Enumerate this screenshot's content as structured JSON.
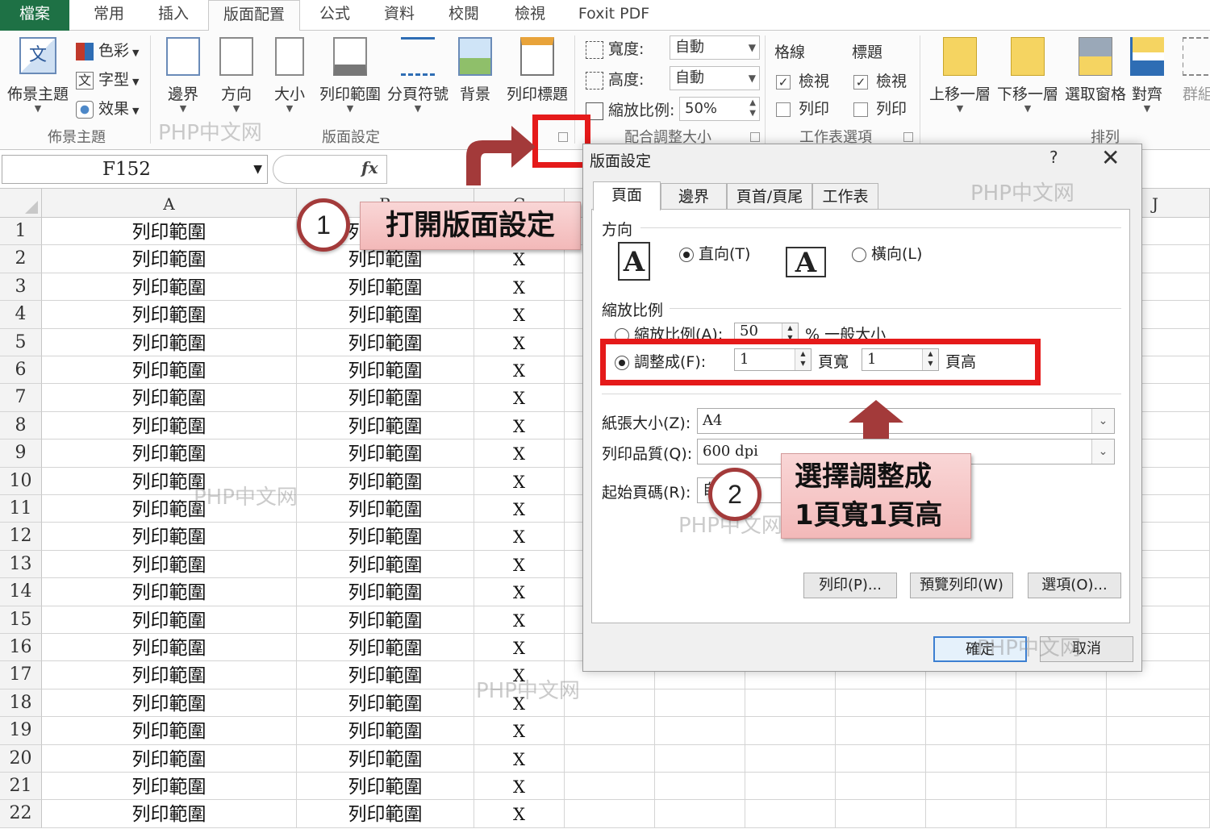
{
  "tabs": [
    "檔案",
    "常用",
    "插入",
    "版面配置",
    "公式",
    "資料",
    "校閱",
    "檢視",
    "Foxit PDF"
  ],
  "ribbon": {
    "theme_group": {
      "theme_button": "佈景主題",
      "colors": "色彩",
      "fonts": "字型",
      "effects": "效果",
      "label": "佈景主題"
    },
    "page_setup_group": {
      "buttons": [
        "邊界",
        "方向",
        "大小",
        "列印範圍",
        "分頁符號",
        "背景",
        "列印標題"
      ],
      "label": "版面設定"
    },
    "scale_group": {
      "width_label": "寬度:",
      "width_value": "自動",
      "height_label": "高度:",
      "height_value": "自動",
      "scale_label": "縮放比例:",
      "scale_value": "50%",
      "label": "配合調整大小"
    },
    "sheet_options_group": {
      "gridlines": "格線",
      "headings": "標題",
      "view": "檢視",
      "print": "列印",
      "label": "工作表選項"
    },
    "arrange_group": {
      "buttons": [
        "上移一層",
        "下移一層",
        "選取窗格",
        "對齊",
        "群組"
      ],
      "label": "排列"
    }
  },
  "formula_bar": {
    "name_box": "F152",
    "fx": "fx"
  },
  "sheet": {
    "columns": [
      "A",
      "B",
      "C",
      "J"
    ],
    "cell_text_a": "列印範圍",
    "cell_text_b": "列印範圍",
    "cell_text_c": "X",
    "rows": [
      1,
      2,
      3,
      4,
      5,
      6,
      7,
      8,
      9,
      10,
      11,
      12,
      13,
      14,
      15,
      16,
      17,
      18,
      19,
      20,
      21,
      22
    ]
  },
  "dialog": {
    "title": "版面設定",
    "help": "?",
    "close": "✕",
    "tabs": [
      "頁面",
      "邊界",
      "頁首/頁尾",
      "工作表"
    ],
    "orientation_section": "方向",
    "portrait": "直向(T)",
    "landscape": "橫向(L)",
    "scaling_section": "縮放比例",
    "adjust_to": "縮放比例(A):",
    "adjust_value": "50",
    "adjust_suffix": "% 一般大小",
    "fit_to": "調整成(F):",
    "fit_wide_value": "1",
    "fit_wide_label": "頁寬",
    "fit_tall_value": "1",
    "fit_tall_label": "頁高",
    "paper_size_label": "紙張大小(Z):",
    "paper_size_value": "A4",
    "print_quality_label": "列印品質(Q):",
    "print_quality_value": "600 dpi",
    "first_page_label": "起始頁碼(R):",
    "first_page_value": "自動",
    "print_button": "列印(P)...",
    "preview_button": "預覽列印(W)",
    "options_button": "選項(O)...",
    "ok_button": "確定",
    "cancel_button": "取消"
  },
  "annotations": {
    "step1_number": "1",
    "step1_text": "打開版面設定",
    "step2_number": "2",
    "step2_line1": "選擇調整成",
    "step2_line2": "1頁寬1頁高",
    "watermark": "PHP中文网"
  },
  "colors": {
    "file_tab": "#1e7145",
    "annotation_red": "#e51a1a",
    "callout_bg": "#f3b9b9",
    "arrow_red": "#a33a3a"
  }
}
